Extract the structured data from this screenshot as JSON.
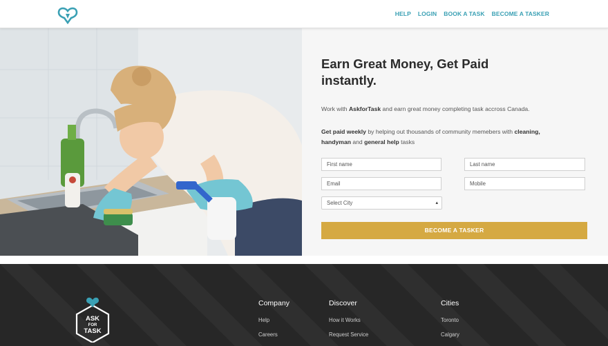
{
  "header": {
    "nav": [
      "HELP",
      "LOGIN",
      "BOOK A TASK",
      "BECOME A TASKER"
    ]
  },
  "hero": {
    "headline": "Earn Great Money, Get Paid instantly.",
    "p1": {
      "pre": "Work with ",
      "brand": "AskforTask",
      "post": " and earn great money completing task accross Canada."
    },
    "p2": {
      "bold1": "Get paid weekly",
      "mid": " by helping out thousands of community memebers with ",
      "bold2": "cleaning, handyman",
      "mid2": " and ",
      "bold3": "general help",
      "post": " tasks"
    }
  },
  "form": {
    "first_name": "First name",
    "last_name": "Last name",
    "email": "Email",
    "mobile": "Mobile",
    "city": "Select City",
    "submit": "BECOME A TASKER"
  },
  "footer": {
    "logo_text": [
      "ASK",
      "FOR",
      "TASK"
    ],
    "columns": [
      {
        "title": "Company",
        "links": [
          "Help",
          "Careers"
        ]
      },
      {
        "title": "Discover",
        "links": [
          "How it Works",
          "Request Service"
        ]
      },
      {
        "title": "Cities",
        "links": [
          "Toronto",
          "Calgary"
        ]
      }
    ]
  },
  "colors": {
    "accent": "#3aa0b4",
    "cta": "#d5a942",
    "footer_bg": "#272727"
  }
}
